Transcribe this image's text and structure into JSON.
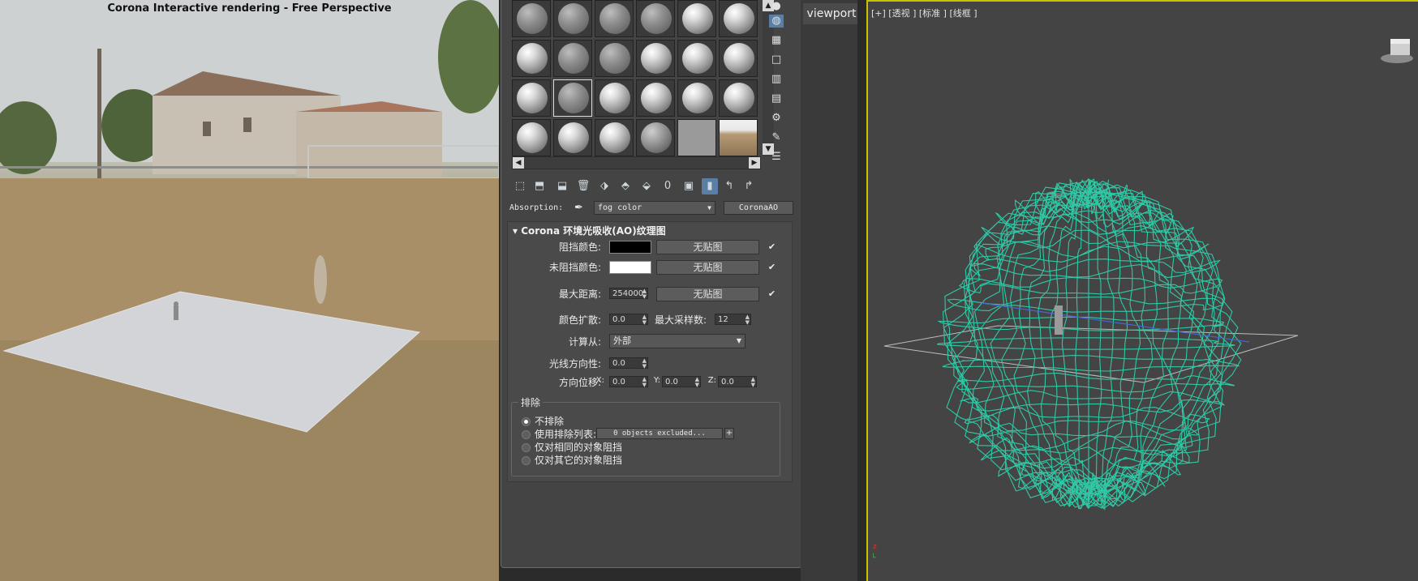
{
  "render": {
    "title": "Corona Interactive rendering - Free Perspective"
  },
  "material_editor": {
    "absorption_label": "Absorption:",
    "absorption_value": "fog color",
    "absorption_map": "CoronaAO",
    "rollout_title": "Corona 环境光吸收(AO)纹理图",
    "occluded_color_label": "阻挡颜色:",
    "unoccluded_color_label": "未阻挡颜色:",
    "max_distance_label": "最大距离:",
    "max_distance_value": "254000",
    "no_map": "无贴图",
    "color_spread_label": "颜色扩散:",
    "color_spread_value": "0.0",
    "max_samples_label": "最大采样数:",
    "max_samples_value": "12",
    "calc_from_label": "计算从:",
    "calc_from_value": "外部",
    "ray_directionality_label": "光线方向性:",
    "ray_directionality_value": "0.0",
    "dir_offset_label": "方向位移:",
    "x_label": "X:",
    "x_value": "0.0",
    "y_label": "Y:",
    "y_value": "0.0",
    "z_label": "Z:",
    "z_value": "0.0",
    "exclude_group": "排除",
    "opt_no_exclude": "不排除",
    "opt_use_list": "使用排除列表:",
    "objects_excluded": "0 objects excluded...",
    "opt_same_only": "仅对相同的对象阻挡",
    "opt_other_only": "仅对其它的对象阻挡"
  },
  "middle": {
    "viewport_tab": "viewport"
  },
  "viewport": {
    "label": "[+] [透视 ] [标准 ] [线框 ]",
    "wire_color": "#2fc9a6"
  }
}
